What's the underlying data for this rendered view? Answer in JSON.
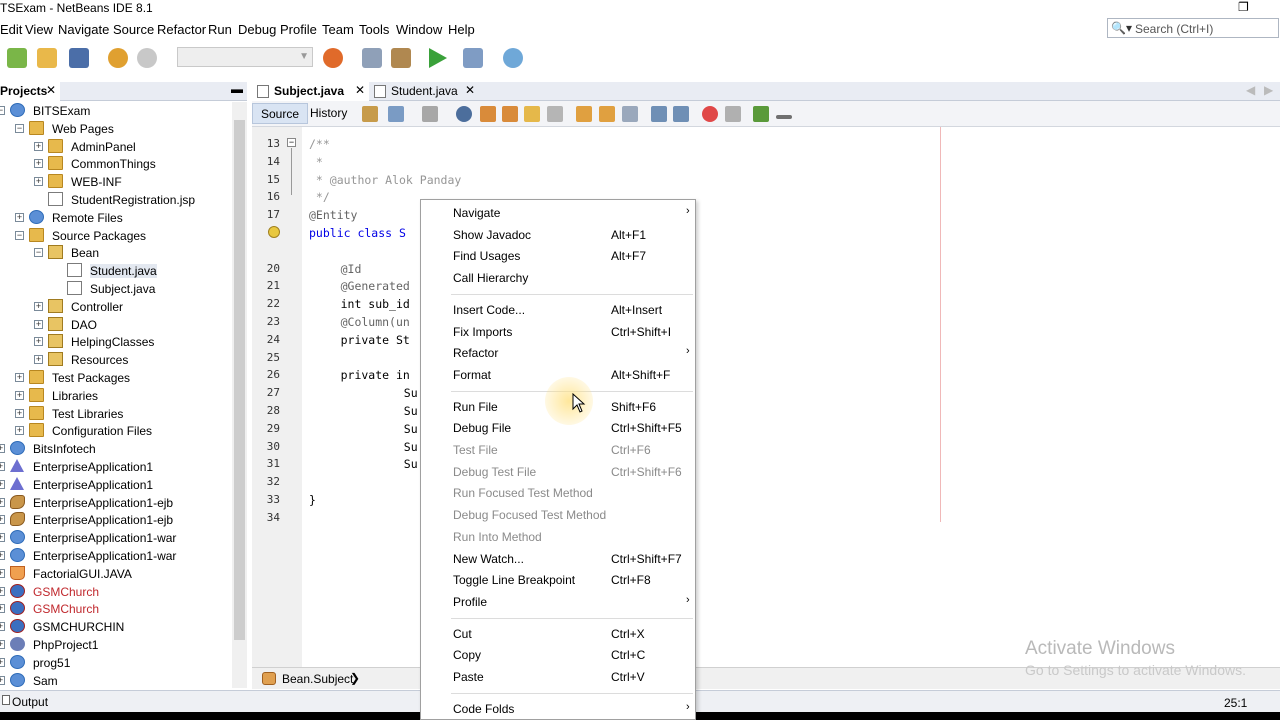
{
  "window": {
    "title": "TSExam - NetBeans IDE 8.1"
  },
  "menubar": {
    "items": [
      "Edit",
      "View",
      "Navigate",
      "Source",
      "Refactor",
      "Run",
      "Debug",
      "Profile",
      "Team",
      "Tools",
      "Window",
      "Help"
    ]
  },
  "search": {
    "placeholder": "Search (Ctrl+I)"
  },
  "projects": {
    "tab_label": "Projects",
    "tree": [
      {
        "label": "BITSExam",
        "icon": "globe-icon"
      },
      {
        "label": "Web Pages",
        "icon": "folder-icon"
      },
      {
        "label": "AdminPanel",
        "icon": "folder-icon"
      },
      {
        "label": "CommonThings",
        "icon": "folder-icon"
      },
      {
        "label": "WEB-INF",
        "icon": "folder-icon"
      },
      {
        "label": "StudentRegistration.jsp",
        "icon": "file-icon"
      },
      {
        "label": "Remote Files",
        "icon": "globe-icon"
      },
      {
        "label": "Source Packages",
        "icon": "folder-icon"
      },
      {
        "label": "Bean",
        "icon": "package-icon"
      },
      {
        "label": "Student.java",
        "icon": "java-file-icon"
      },
      {
        "label": "Subject.java",
        "icon": "java-file-icon"
      },
      {
        "label": "Controller",
        "icon": "package-icon"
      },
      {
        "label": "DAO",
        "icon": "package-icon"
      },
      {
        "label": "HelpingClasses",
        "icon": "package-icon"
      },
      {
        "label": "Resources",
        "icon": "package-icon"
      },
      {
        "label": "Test Packages",
        "icon": "folder-icon"
      },
      {
        "label": "Libraries",
        "icon": "folder-icon"
      },
      {
        "label": "Test Libraries",
        "icon": "folder-icon"
      },
      {
        "label": "Configuration Files",
        "icon": "folder-icon"
      },
      {
        "label": "BitsInfotech",
        "icon": "globe-icon"
      },
      {
        "label": "EnterpriseApplication1",
        "icon": "enterprise-icon"
      },
      {
        "label": "EnterpriseApplication1",
        "icon": "enterprise-icon"
      },
      {
        "label": "EnterpriseApplication1-ejb",
        "icon": "bean-icon"
      },
      {
        "label": "EnterpriseApplication1-ejb",
        "icon": "bean-icon"
      },
      {
        "label": "EnterpriseApplication1-war",
        "icon": "globe-icon"
      },
      {
        "label": "EnterpriseApplication1-war",
        "icon": "globe-icon"
      },
      {
        "label": "FactorialGUI.JAVA",
        "icon": "java-project-icon"
      },
      {
        "label": "GSMChurch",
        "icon": "gsm-icon"
      },
      {
        "label": "GSMChurch",
        "icon": "gsm-icon"
      },
      {
        "label": "GSMCHURCHIN",
        "icon": "gsm-icon"
      },
      {
        "label": "PhpProject1",
        "icon": "php-icon"
      },
      {
        "label": "prog51",
        "icon": "globe-icon"
      },
      {
        "label": "Sam",
        "icon": "globe-icon"
      }
    ]
  },
  "editor": {
    "tabs": [
      {
        "label": "Subject.java",
        "active": true
      },
      {
        "label": "Student.java",
        "active": false
      }
    ],
    "source_label": "Source",
    "history_label": "History",
    "lines": [
      {
        "n": "13",
        "text": "/**",
        "cls": "cmt",
        "indent": 0
      },
      {
        "n": "14",
        "text": " *",
        "cls": "cmt",
        "indent": 0
      },
      {
        "n": "15",
        "text": " * @author Alok Panday",
        "cls": "cmt",
        "indent": 0
      },
      {
        "n": "16",
        "text": " */",
        "cls": "cmt",
        "indent": 0
      },
      {
        "n": "17",
        "text": "@Entity",
        "cls": "ann",
        "indent": 0
      },
      {
        "n": "",
        "text": "public class S",
        "cls": "kw",
        "indent": 0
      },
      {
        "n": "",
        "text": "",
        "cls": "",
        "indent": 0
      },
      {
        "n": "20",
        "text": "@Id",
        "cls": "ann",
        "indent": 4
      },
      {
        "n": "21",
        "text": "@Generated",
        "cls": "ann",
        "indent": 4
      },
      {
        "n": "22",
        "text": "int sub_id",
        "cls": "",
        "indent": 4
      },
      {
        "n": "23",
        "text": "@Column(un",
        "cls": "ann",
        "indent": 4
      },
      {
        "n": "24",
        "text": "private St",
        "cls": "",
        "indent": 4
      },
      {
        "n": "25",
        "text": "",
        "cls": "",
        "indent": 0
      },
      {
        "n": "26",
        "text": "private in",
        "cls": "",
        "indent": 4
      },
      {
        "n": "27",
        "text": "Su",
        "cls": "",
        "indent": 12
      },
      {
        "n": "28",
        "text": "Su",
        "cls": "",
        "indent": 12
      },
      {
        "n": "29",
        "text": "Su",
        "cls": "",
        "indent": 12
      },
      {
        "n": "30",
        "text": "Su",
        "cls": "",
        "indent": 12
      },
      {
        "n": "31",
        "text": "Su",
        "cls": "",
        "indent": 12
      },
      {
        "n": "32",
        "text": "",
        "cls": "",
        "indent": 0
      },
      {
        "n": "33",
        "text": "}",
        "cls": "",
        "indent": 0
      },
      {
        "n": "34",
        "text": "",
        "cls": "",
        "indent": 0
      }
    ]
  },
  "breadcrumb": {
    "label": "Bean.Subject"
  },
  "statusbar": {
    "output_label": "Output",
    "position": "25:1"
  },
  "context_menu": {
    "items": [
      {
        "label": "Navigate",
        "shortcut": "",
        "submenu": true,
        "disabled": false
      },
      {
        "label": "Show Javadoc",
        "shortcut": "Alt+F1",
        "submenu": false,
        "disabled": false
      },
      {
        "label": "Find Usages",
        "shortcut": "Alt+F7",
        "submenu": false,
        "disabled": false
      },
      {
        "label": "Call Hierarchy",
        "shortcut": "",
        "submenu": false,
        "disabled": false
      },
      {
        "sep": true
      },
      {
        "label": "Insert Code...",
        "shortcut": "Alt+Insert",
        "submenu": false,
        "disabled": false
      },
      {
        "label": "Fix Imports",
        "shortcut": "Ctrl+Shift+I",
        "submenu": false,
        "disabled": false
      },
      {
        "label": "Refactor",
        "shortcut": "",
        "submenu": true,
        "disabled": false
      },
      {
        "label": "Format",
        "shortcut": "Alt+Shift+F",
        "submenu": false,
        "disabled": false
      },
      {
        "sep": true
      },
      {
        "label": "Run File",
        "shortcut": "Shift+F6",
        "submenu": false,
        "disabled": false
      },
      {
        "label": "Debug File",
        "shortcut": "Ctrl+Shift+F5",
        "submenu": false,
        "disabled": false
      },
      {
        "label": "Test File",
        "shortcut": "Ctrl+F6",
        "submenu": false,
        "disabled": true
      },
      {
        "label": "Debug Test File",
        "shortcut": "Ctrl+Shift+F6",
        "submenu": false,
        "disabled": true
      },
      {
        "label": "Run Focused Test Method",
        "shortcut": "",
        "submenu": false,
        "disabled": true
      },
      {
        "label": "Debug Focused Test Method",
        "shortcut": "",
        "submenu": false,
        "disabled": true
      },
      {
        "label": "Run Into Method",
        "shortcut": "",
        "submenu": false,
        "disabled": true
      },
      {
        "label": "New Watch...",
        "shortcut": "Ctrl+Shift+F7",
        "submenu": false,
        "disabled": false
      },
      {
        "label": "Toggle Line Breakpoint",
        "shortcut": "Ctrl+F8",
        "submenu": false,
        "disabled": false
      },
      {
        "label": "Profile",
        "shortcut": "",
        "submenu": true,
        "disabled": false
      },
      {
        "sep": true
      },
      {
        "label": "Cut",
        "shortcut": "Ctrl+X",
        "submenu": false,
        "disabled": false
      },
      {
        "label": "Copy",
        "shortcut": "Ctrl+C",
        "submenu": false,
        "disabled": false
      },
      {
        "label": "Paste",
        "shortcut": "Ctrl+V",
        "submenu": false,
        "disabled": false
      },
      {
        "sep": true
      },
      {
        "label": "Code Folds",
        "shortcut": "",
        "submenu": true,
        "disabled": false
      }
    ]
  },
  "watermark": {
    "line1": "Activate Windows",
    "line2": "Go to Settings to activate Windows."
  },
  "colors": {
    "accent": "#2f6cb8",
    "current_line": "#e9effa",
    "comment": "#969696",
    "keyword": "#0000e6"
  }
}
